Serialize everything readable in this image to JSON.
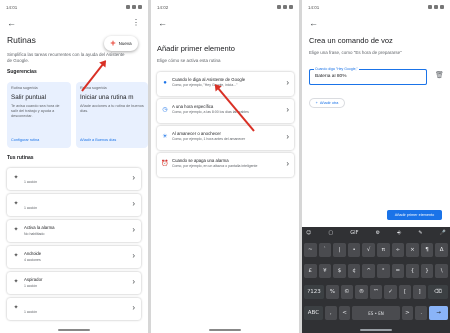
{
  "status_time": "14:01",
  "status_time_2": "14:02",
  "status_time_3": "14:01",
  "routines": {
    "title": "Rutinas",
    "description": "Simplifica las tareas recurrentes con la ayuda del Asistente de Google.",
    "new_button": "Nueva",
    "suggestions_heading": "Sugerencias",
    "suggestions": [
      {
        "tag": "Rutina sugerida",
        "title": "Salir puntual",
        "desc": "Te avisa cuando sea hora de salir del trabajo y ayuda a desconectar.",
        "link": "Configurar rutina"
      },
      {
        "tag": "Rutina sugerida",
        "title": "Iniciar una rutina m",
        "desc": "Añade acciones a tu rutina de buenos días.",
        "link": "Añadir a Buenos días"
      }
    ],
    "your_routines_heading": "Tus rutinas",
    "items": [
      {
        "name": "",
        "actions": "1 acción",
        "icon": "wand-icon"
      },
      {
        "name": "",
        "actions": "1 acción",
        "icon": "wand-icon"
      },
      {
        "name": "Activa la alarma",
        "actions": "No habilitado",
        "icon": "wand-icon"
      },
      {
        "name": "Androide",
        "actions": "4 acciones",
        "icon": "wand-icon"
      },
      {
        "name": "Aspirador",
        "actions": "1 acción",
        "icon": "wand-icon"
      },
      {
        "name": "",
        "actions": "1 acción",
        "icon": "wand-icon"
      }
    ]
  },
  "first_element": {
    "title": "Añadir primer elemento",
    "subtitle": "Elige cómo se activa esta rutina",
    "options": [
      {
        "title": "Cuando le diga al Asistente de Google",
        "desc": "Como, por ejemplo, \"Hey Google, inicia...\"",
        "icon": "mic-icon"
      },
      {
        "title": "A una hora específica",
        "desc": "Como, por ejemplo, a las 8:00 los días laborables",
        "icon": "clock-icon"
      },
      {
        "title": "Al amanecer o anochecer",
        "desc": "Como, por ejemplo, 1 hora antes del amanecer",
        "icon": "sun-icon"
      },
      {
        "title": "Cuando se apaga una alarma",
        "desc": "Como, por ejemplo, en un altavoz o pantalla inteligente",
        "icon": "alarm-icon"
      }
    ]
  },
  "voice_command": {
    "title": "Crea un comando de voz",
    "hint": "Elige una frase, como \"Es hora de prepararse\"",
    "field_label": "Cuando diga \"Hey Google,\"",
    "field_value": "Batería al 80%",
    "add_button": "Añadir otra",
    "primary_button": "Añadir primer elemento"
  },
  "keyboard": {
    "top": [
      "☺",
      "▢",
      "GIF",
      "⚙",
      "⎆",
      "✎",
      "🎤"
    ],
    "rows": [
      [
        "~",
        "`",
        "|",
        "•",
        "√",
        "π",
        "÷",
        "×",
        "¶",
        "Δ"
      ],
      [
        "£",
        "¥",
        "$",
        "¢",
        "^",
        "°",
        "=",
        "{",
        "}",
        "\\"
      ],
      [
        "?123",
        "%",
        "©",
        "®",
        "™",
        "✓",
        "[",
        "]",
        "⌫"
      ],
      [
        "ABC",
        ",",
        "<",
        "ES • EN",
        ">",
        ".",
        "→"
      ]
    ]
  },
  "colors": {
    "accent": "#1a73e8",
    "arrow": "#d93025",
    "suggestion_bg": "#e8f0fe"
  }
}
